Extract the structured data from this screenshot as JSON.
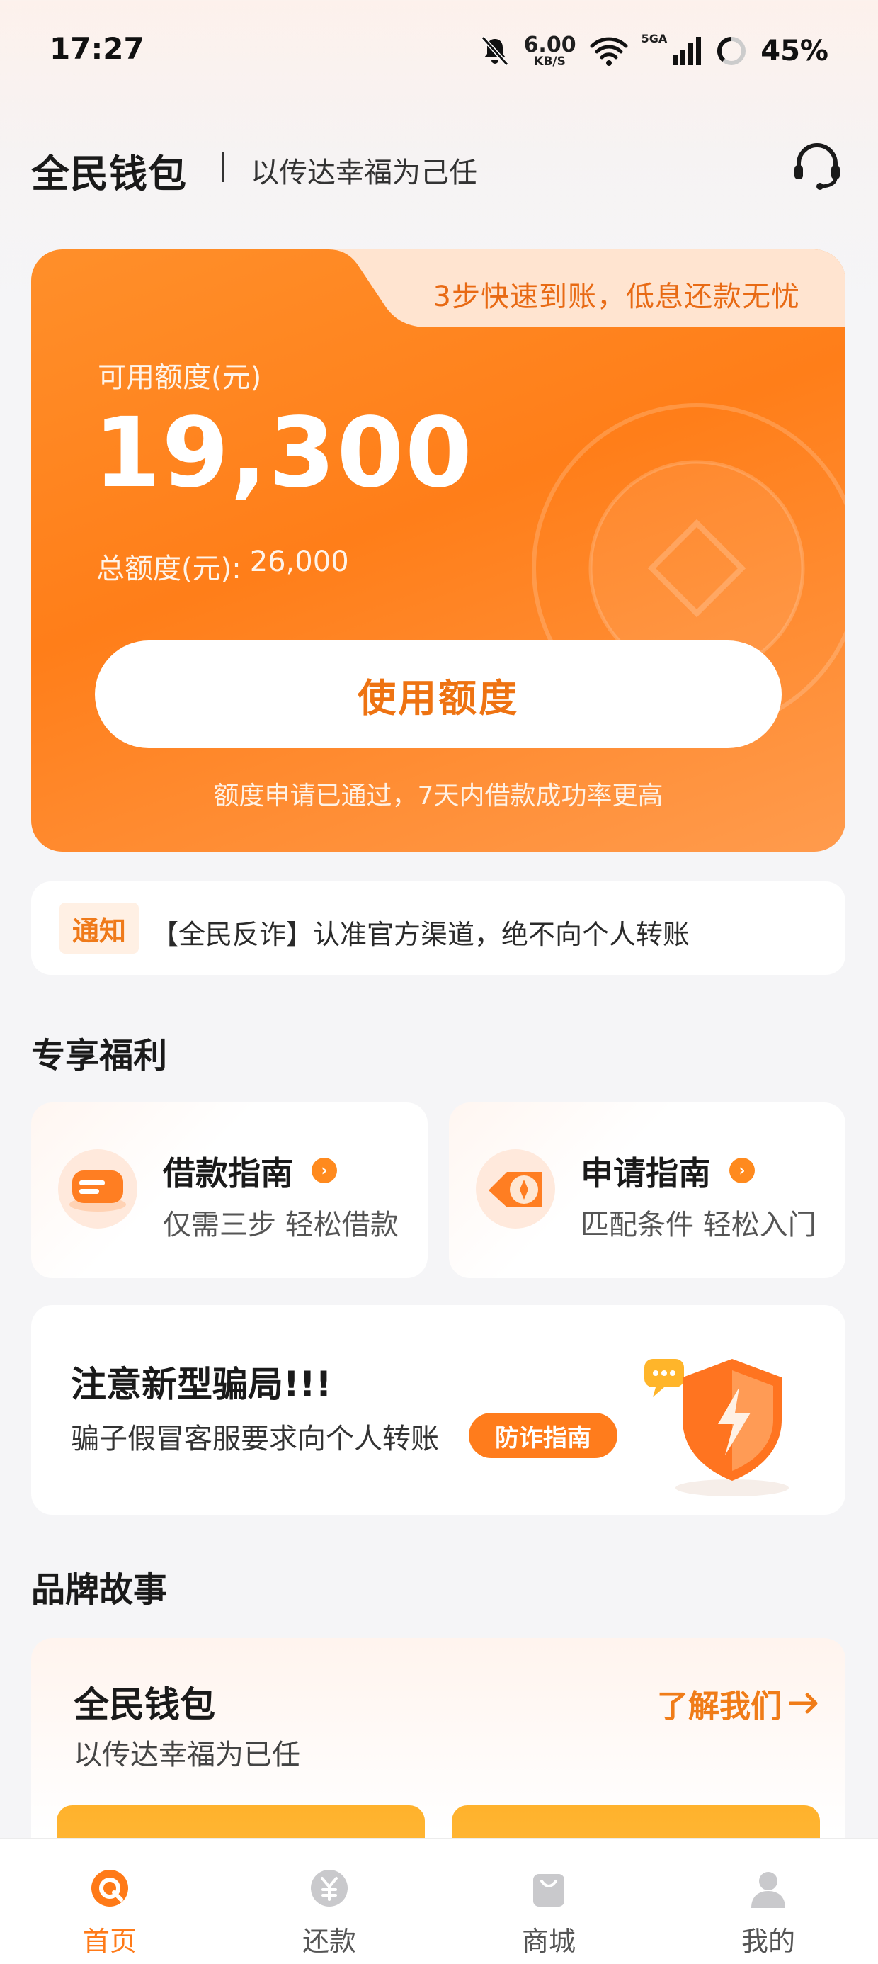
{
  "status_bar": {
    "time": "17:27",
    "net_speed_value": "6.00",
    "net_speed_unit": "KB/S",
    "signal_type": "5GA",
    "battery": "45%"
  },
  "header": {
    "brand": "全民钱包",
    "slogan": "以传达幸福为己任",
    "service_icon": "headset-icon"
  },
  "credit_card": {
    "banner": "3步快速到账，低息还款无忧",
    "available_label": "可用额度(元)",
    "available_amount": "19,300",
    "total_label": "总额度(元):",
    "total_amount": "26,000",
    "button_label": "使用额度",
    "tip": "额度申请已通过，7天内借款成功率更高"
  },
  "notice": {
    "badge": "通知",
    "text": "【全民反诈】认准官方渠道，绝不向个人转账"
  },
  "benefits": {
    "title": "专享福利",
    "items": [
      {
        "title": "借款指南",
        "subtitle": "仅需三步 轻松借款",
        "icon": "loan-guide-icon"
      },
      {
        "title": "申请指南",
        "subtitle": "匹配条件 轻松入门",
        "icon": "apply-guide-icon"
      }
    ]
  },
  "fraud": {
    "title": "注意新型骗局!!!",
    "subtitle": "骗子假冒客服要求向个人转账",
    "button": "防诈指南"
  },
  "story": {
    "section_title": "品牌故事",
    "title": "全民钱包",
    "subtitle": "以传达幸福为已任",
    "link": "了解我们"
  },
  "nav": {
    "items": [
      {
        "label": "首页",
        "icon": "home-icon",
        "active": true
      },
      {
        "label": "还款",
        "icon": "repay-icon",
        "active": false
      },
      {
        "label": "商城",
        "icon": "shop-bag-icon",
        "active": false
      },
      {
        "label": "我的",
        "icon": "profile-icon",
        "active": false
      }
    ]
  },
  "colors": {
    "accent": "#ff7e19",
    "accent_text": "#ee7312",
    "background": "#f5f5f7"
  }
}
